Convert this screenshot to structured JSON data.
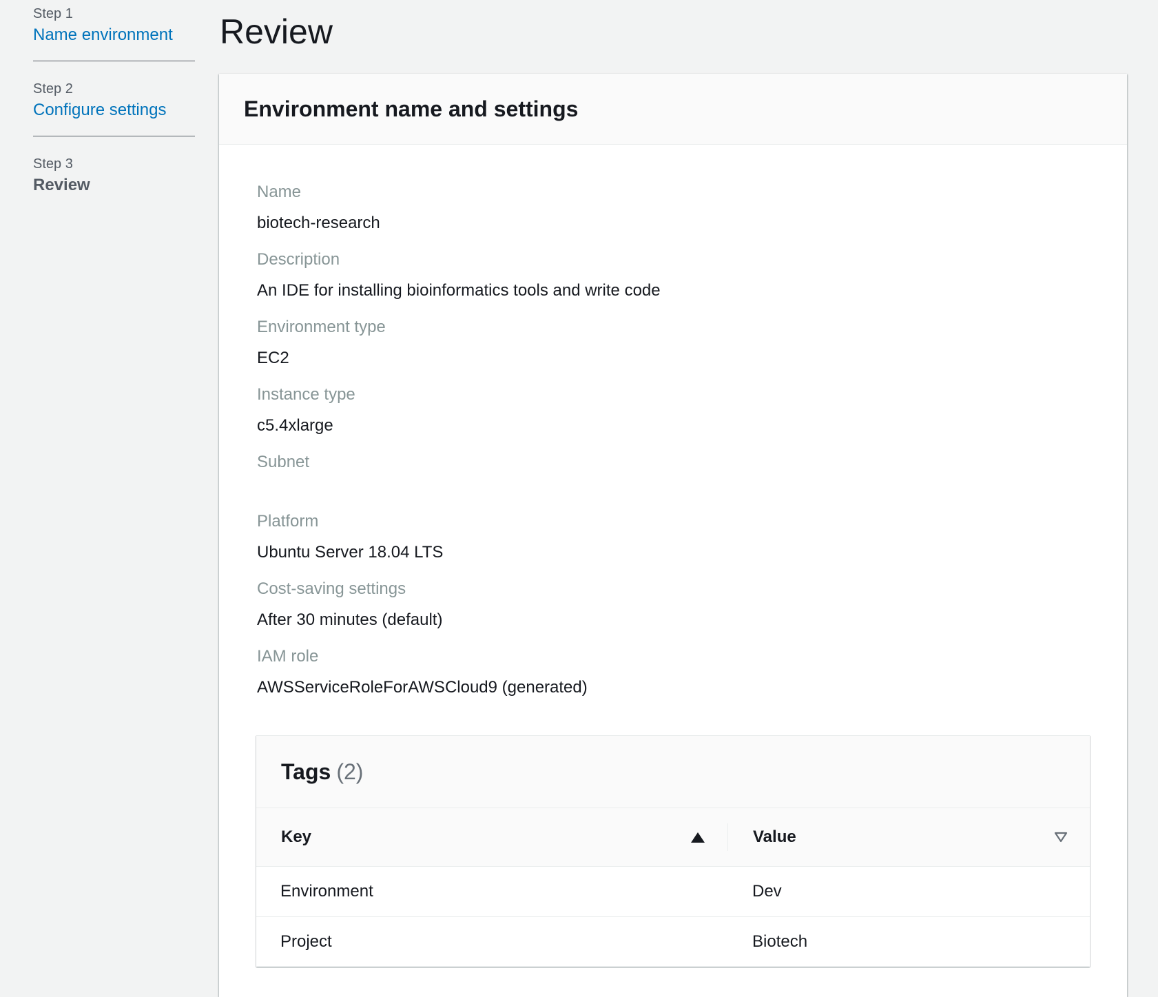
{
  "wizard": {
    "steps": [
      {
        "number": "Step 1",
        "label": "Name environment"
      },
      {
        "number": "Step 2",
        "label": "Configure settings"
      },
      {
        "number": "Step 3",
        "label": "Review"
      }
    ]
  },
  "page": {
    "title": "Review"
  },
  "panel": {
    "title": "Environment name and settings",
    "fields": [
      {
        "label": "Name",
        "value": "biotech-research"
      },
      {
        "label": "Description",
        "value": "An IDE for installing bioinformatics tools and write code"
      },
      {
        "label": "Environment type",
        "value": "EC2"
      },
      {
        "label": "Instance type",
        "value": "c5.4xlarge"
      },
      {
        "label": "Subnet",
        "value": ""
      },
      {
        "label": "Platform",
        "value": "Ubuntu Server 18.04 LTS"
      },
      {
        "label": "Cost-saving settings",
        "value": "After 30 minutes (default)"
      },
      {
        "label": "IAM role",
        "value": "AWSServiceRoleForAWSCloud9 (generated)"
      }
    ]
  },
  "tags": {
    "title": "Tags",
    "count": "(2)",
    "columns": {
      "key": "Key",
      "value": "Value"
    },
    "rows": [
      {
        "key": "Environment",
        "value": "Dev"
      },
      {
        "key": "Project",
        "value": "Biotech"
      }
    ]
  },
  "colors": {
    "link": "#0073bb",
    "muted_label": "#879596",
    "background": "#f2f3f3"
  }
}
